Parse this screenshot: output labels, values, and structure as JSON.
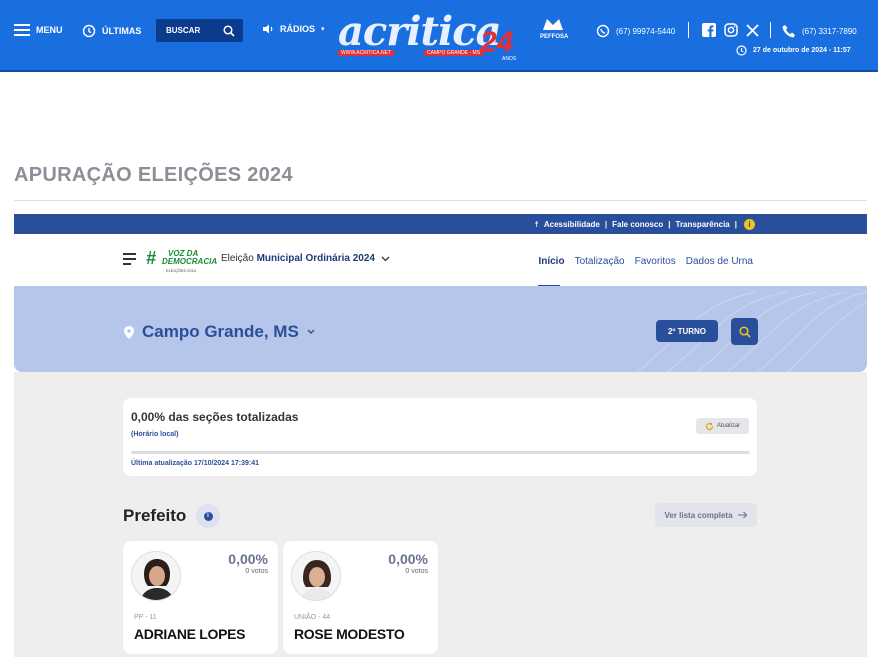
{
  "topbar": {
    "menu_label": "MENU",
    "ultimas_label": "ÚLTIMAS",
    "search_label": "BUSCAR",
    "radios_label": "RÁDIOS",
    "logo_text": "acritica",
    "logo_years": "24",
    "logo_url": "WWW.ACRITICA.NET",
    "logo_city": "CAMPO GRANDE - MS",
    "logo_anos": "ANOS",
    "badge_text": "PEFFOSA",
    "whatsapp": "(67) 99974-5440",
    "phone": "(67) 3317-7890",
    "datetime": "27 de outubro de 2024 - 11:57"
  },
  "page": {
    "title": "APURAÇÃO ELEIÇÕES 2024"
  },
  "accessbar": {
    "acessibilidade": "Acessibilidade",
    "fale": "Fale conosco",
    "transparencia": "Transparência",
    "sep": "|"
  },
  "nav": {
    "logo_hash": "#",
    "logo_line1": "VOZ DA",
    "logo_line2": "DEMOCRACIA",
    "logo_sub": "ELEIÇÕES 2024",
    "eleicao_prefix": "Eleição",
    "eleicao_name": "Municipal Ordinária 2024",
    "links": [
      "Início",
      "Totalização",
      "Favoritos",
      "Dados de Urna"
    ]
  },
  "hero": {
    "city": "Campo Grande, MS",
    "turno": "2º TURNO"
  },
  "status": {
    "title": "0,00% das seções totalizadas",
    "local": "(Horário local)",
    "atualizar": "Atualizar",
    "progress": 0,
    "ultima": "Última atualização 17/10/2024 17:39:41"
  },
  "prefeito": {
    "title": "Prefeito",
    "ver_lista": "Ver lista completa"
  },
  "candidates": [
    {
      "pct": "0,00%",
      "votos": "0 votos",
      "party": "PP - 11",
      "name": "ADRIANE LOPES"
    },
    {
      "pct": "0,00%",
      "votos": "0 votos",
      "party": "UNIÃO - 44",
      "name": "ROSE MODESTO"
    }
  ],
  "colors": {
    "topbar": "#1a6fe0",
    "brand": "#2a4f9a",
    "hero": "#b6c6ea",
    "accent_yellow": "#f3c21b"
  },
  "icons": [
    "menu-icon",
    "history-icon",
    "search-icon",
    "speaker-icon",
    "whatsapp-icon",
    "facebook-icon",
    "instagram-icon",
    "x-icon",
    "phone-icon",
    "clock-icon",
    "accessibility-icon",
    "info-icon",
    "chevron-down-icon",
    "location-pin-icon",
    "refresh-icon",
    "arrow-right-icon"
  ]
}
